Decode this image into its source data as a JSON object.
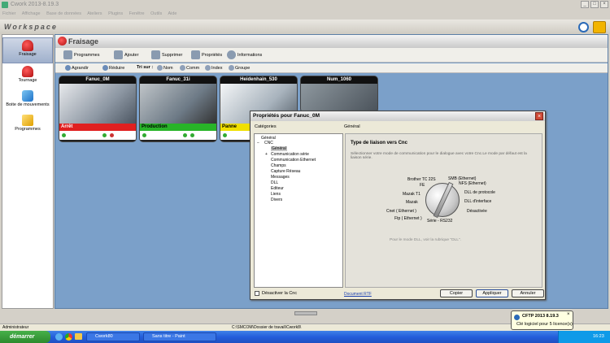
{
  "window": {
    "title": "Cwork 2013-8.19.3",
    "min": "_",
    "max": "□",
    "close": "×"
  },
  "menu": [
    "Fichier",
    "Affichage",
    "Base de données",
    "Ateliers",
    "Plugins",
    "Fenêtre",
    "Outils",
    "Aide"
  ],
  "workspace": {
    "title": "Workspace"
  },
  "sidebar": {
    "items": [
      {
        "label": "Fraisage"
      },
      {
        "label": "Tournage"
      },
      {
        "label": "Boite de mouvements"
      },
      {
        "label": "Programmes"
      }
    ]
  },
  "main": {
    "title": "Fraisage"
  },
  "toolbar": {
    "programmes": "Programmes",
    "ajouter": "Ajouter",
    "supprimer": "Supprimer",
    "proprietes": "Propriétés",
    "informations": "Informations"
  },
  "sortbar": {
    "agrandir": "Agrandir",
    "reduire": "Réduire",
    "tri_label": "Tri sur :",
    "nom": "Nom",
    "comm": "Comm",
    "index": "Index",
    "groupe": "Groupe"
  },
  "machines": [
    {
      "name": "Fanuc_0M",
      "status": "Arrêt",
      "status_color": "#e02020"
    },
    {
      "name": "Fanuc_31i",
      "status": "Production",
      "status_color": "#28b428"
    },
    {
      "name": "Heidenhain_530",
      "status": "Panne",
      "status_color": "#f0e000"
    },
    {
      "name": "Num_1060",
      "status": "",
      "status_color": ""
    }
  ],
  "dialog": {
    "title": "Propriétés pour Fanuc_0M",
    "close": "×",
    "categories_label": "Catégories",
    "general_label": "Général",
    "tree": [
      "Général",
      "CNC",
      "Général",
      "Communication série",
      "Communication Ethernet",
      "Champs",
      "Capture Réseau",
      "Messages",
      "DLL",
      "Editeur",
      "Liens",
      "Divers"
    ],
    "panel_title": "Type de liaison vers Cnc",
    "panel_desc": "Sélectionner votre mode de communication pour le dialogue avec votre Cnc.Le mode par défaut est la liaison série.",
    "dial_labels": [
      "Brother TC 22S",
      "FE",
      "Mazak T1",
      "Mazak",
      "Cnet ( Ethernet )",
      "Ftp ( Ethernet )",
      "Série - RS232",
      "Désactivée",
      "DLL d'interface",
      "DLL de protocole",
      "NFS (Ethernet)",
      "SMB (Ethernet)"
    ],
    "dll_hint": "Pour le mode DLL, voir la rubrique \"DLL\".",
    "disable_label": "Désactiver la Cnc",
    "doc_link": "Document RTF",
    "copy": "Copier",
    "apply": "Appliquer",
    "cancel": "Annuler"
  },
  "statusbar": {
    "user": "Administrateur",
    "path": "C:\\SMCOM\\Dossier de travail\\Cwork8\\"
  },
  "taskbar": {
    "start": "démarrer",
    "tasks": [
      "Cwork80",
      "Sans titre - Paint"
    ],
    "clock": "16:23"
  },
  "balloon": {
    "title": "CFTP 2013 8.19.3",
    "text": "Clé logiciel pour 5 licence(s)",
    "close": "×"
  }
}
